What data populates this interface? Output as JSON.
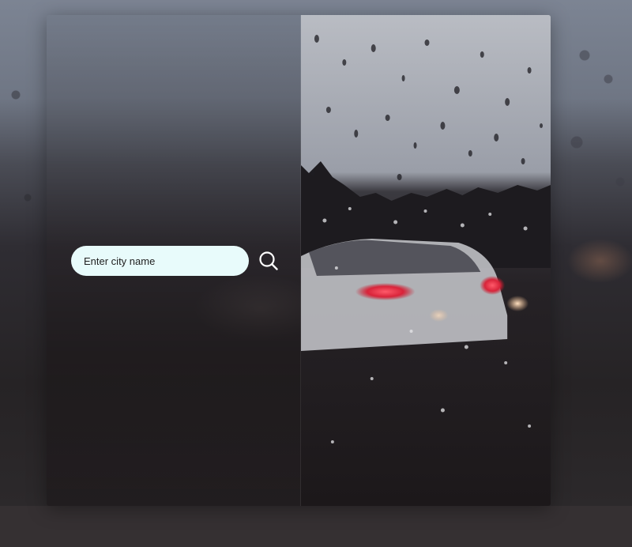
{
  "search": {
    "placeholder": "Enter city name",
    "icon": "search-icon"
  },
  "colors": {
    "input_background": "#e8fbfb",
    "icon_color": "#ffffff"
  }
}
